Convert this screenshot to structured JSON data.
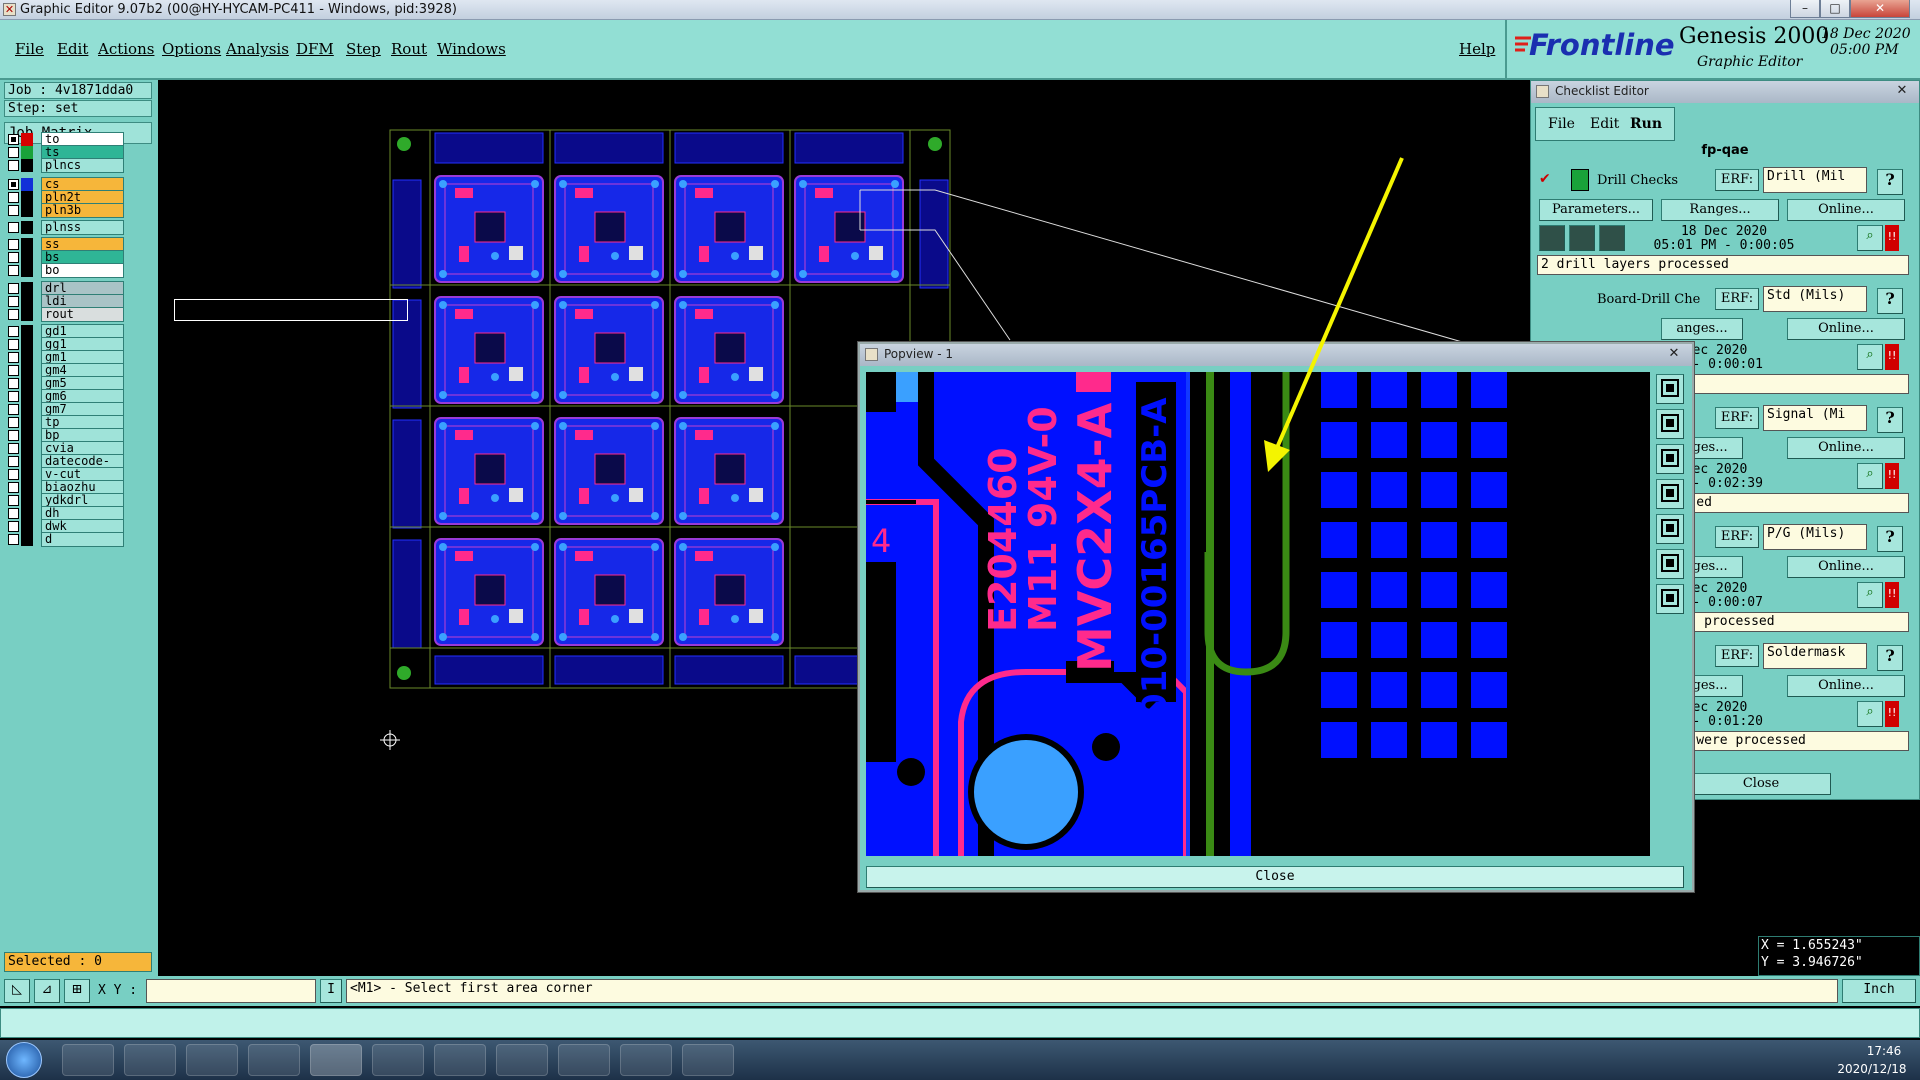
{
  "window": {
    "title": "Graphic Editor 9.07b2 (00@HY-HYCAM-PC411 - Windows, pid:3928)"
  },
  "menu": [
    "File",
    "Edit",
    "Actions",
    "Options",
    "Analysis",
    "DFM",
    "Step",
    "Rout",
    "Windows"
  ],
  "help_label": "Help",
  "branding": {
    "logo": "Frontline",
    "product": "Genesis 2000",
    "subtitle": "Graphic Editor",
    "date": "18 Dec 2020",
    "time": "05:00 PM"
  },
  "job": {
    "job_label": "Job : 4v1871dda0",
    "step_label": "Step: set",
    "matrix_button": "Job Matrix ..."
  },
  "layers": [
    {
      "name": "to",
      "color": "#ffffff",
      "swatch": "#d60000",
      "on": true
    },
    {
      "name": "ts",
      "color": "#2fb596",
      "swatch": "#19a23a",
      "on": false
    },
    {
      "name": "plncs",
      "color": "#9fe3d9",
      "swatch": "#000000",
      "on": false
    },
    {
      "name": "cs",
      "color": "#f6b63a",
      "swatch": "#1230d8",
      "on": true
    },
    {
      "name": "pln2t",
      "color": "#f6b63a",
      "swatch": "#000000",
      "on": false
    },
    {
      "name": "pln3b",
      "color": "#f6b63a",
      "swatch": "#000000",
      "on": false
    },
    {
      "name": "plnss",
      "color": "#9fe3d9",
      "swatch": "#000000",
      "on": false
    },
    {
      "name": "ss",
      "color": "#f6b63a",
      "swatch": "#000000",
      "on": false
    },
    {
      "name": "bs",
      "color": "#2fb596",
      "swatch": "#000000",
      "on": false
    },
    {
      "name": "bo",
      "color": "#ffffff",
      "swatch": "#000000",
      "on": false
    },
    {
      "name": "drl",
      "color": "#a9c3c6",
      "swatch": "#000000",
      "on": false
    },
    {
      "name": "ldi",
      "color": "#a9c3c6",
      "swatch": "#000000",
      "on": false
    },
    {
      "name": "rout",
      "color": "#d9dede",
      "swatch": "#000000",
      "on": false
    },
    {
      "name": "gd1",
      "color": "#9fe3d9",
      "swatch": "#000000",
      "on": false
    },
    {
      "name": "gg1",
      "color": "#9fe3d9",
      "swatch": "#000000",
      "on": false
    },
    {
      "name": "gm1",
      "color": "#9fe3d9",
      "swatch": "#000000",
      "on": false
    },
    {
      "name": "gm4",
      "color": "#9fe3d9",
      "swatch": "#000000",
      "on": false
    },
    {
      "name": "gm5",
      "color": "#9fe3d9",
      "swatch": "#000000",
      "on": false
    },
    {
      "name": "gm6",
      "color": "#9fe3d9",
      "swatch": "#000000",
      "on": false
    },
    {
      "name": "gm7",
      "color": "#9fe3d9",
      "swatch": "#000000",
      "on": false
    },
    {
      "name": "tp",
      "color": "#9fe3d9",
      "swatch": "#000000",
      "on": false
    },
    {
      "name": "bp",
      "color": "#9fe3d9",
      "swatch": "#000000",
      "on": false
    },
    {
      "name": "cvia",
      "color": "#9fe3d9",
      "swatch": "#000000",
      "on": false
    },
    {
      "name": "datecode-to",
      "color": "#9fe3d9",
      "swatch": "#000000",
      "on": false
    },
    {
      "name": "v-cut",
      "color": "#9fe3d9",
      "swatch": "#000000",
      "on": false
    },
    {
      "name": "biaozhu",
      "color": "#9fe3d9",
      "swatch": "#000000",
      "on": false
    },
    {
      "name": "ydkdrl",
      "color": "#9fe3d9",
      "swatch": "#000000",
      "on": false
    },
    {
      "name": "dh",
      "color": "#9fe3d9",
      "swatch": "#000000",
      "on": false
    },
    {
      "name": "dwk",
      "color": "#9fe3d9",
      "swatch": "#000000",
      "on": false
    },
    {
      "name": "d",
      "color": "#9fe3d9",
      "swatch": "#000000",
      "on": false
    }
  ],
  "selected_label": "Selected : 0",
  "checklist": {
    "title": "Checklist Editor",
    "menu": [
      "File",
      "Edit",
      "Run"
    ],
    "name": "fp-qae",
    "close": "Close",
    "btn_params": "Parameters...",
    "btn_ranges": "Ranges...",
    "btn_online": "Online...",
    "btn_ranges_clipped": "anges...",
    "erf_label": "ERF:",
    "help": "?",
    "items": [
      {
        "name": "Drill Checks",
        "erf": "Drill (Mil",
        "date": "18 Dec 2020",
        "time": "05:01 PM - 0:00:05",
        "status": "2 drill layers processed"
      },
      {
        "name": "Board-Drill Che",
        "erf": "Std (Mils)",
        "date": "Dec 2020",
        "time": "PM - 0:00:01",
        "status": "d"
      },
      {
        "name": "",
        "erf": "Signal (Mi",
        "date": "Dec 2020",
        "time": "PM - 0:02:39",
        "status": "cessed"
      },
      {
        "name": "",
        "erf": "P/G (Mils)",
        "date": "Dec 2020",
        "time": "PM - 0:00:07",
        "status": "yers processed"
      },
      {
        "name": "",
        "erf": "Soldermask",
        "date": "Dec 2020",
        "time": "PM - 0:01:20",
        "status": "ers were processed"
      }
    ]
  },
  "popview": {
    "title": "Popview - 1",
    "close": "Close",
    "pcb_text": {
      "ul": "E204460",
      "rating": "M11 94V-0",
      "model": "MVC2X4-A",
      "part": "010-00165PCB-A",
      "digit": "4"
    }
  },
  "coords": {
    "x": "X = 1.655243\"",
    "y": "Y = 3.946726\""
  },
  "bottom": {
    "xy_label": "X Y :",
    "xy_value": "",
    "message": "<M1> - Select first area corner",
    "units": "Inch"
  },
  "taskbar": {
    "time": "17:46",
    "date": "2020/12/18"
  }
}
